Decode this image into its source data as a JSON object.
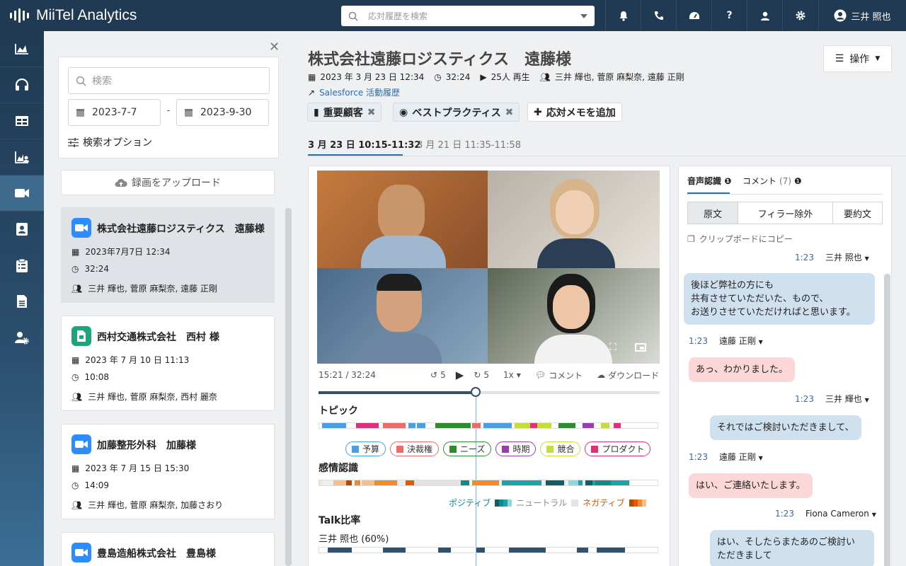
{
  "app": {
    "title": "MiiTel Analytics"
  },
  "search": {
    "placeholder": "応対履歴を検索"
  },
  "user": {
    "name": "三井 照也"
  },
  "left": {
    "search_placeholder": "検索",
    "date_from": "2023-7-7",
    "date_sep": "-",
    "date_to": "2023-9-30",
    "search_options": "検索オプション",
    "upload": "録画をアップロード",
    "items": [
      {
        "title": "株式会社遠藤ロジスティクス　遠藤様",
        "date": "2023年7月7日 12:34",
        "duration": "32:24",
        "people": "三井 輝也, 菅原 麻梨奈, 遠藤 正剛",
        "icon": "video-icon",
        "color": "#2d8cff"
      },
      {
        "title": "西村交通株式会社　西村 様",
        "date": "2023 年 7 月 10 日 11:13",
        "duration": "10:08",
        "people": "三井 輝也, 菅原 麻梨奈, 西村 麗奈",
        "icon": "meet-icon",
        "color": "#1aa67a"
      },
      {
        "title": "加藤整形外科　加藤様",
        "date": "2023 年 7 月 15 日 15:30",
        "duration": "14:09",
        "people": "三井 輝也, 菅原 麻梨奈, 加藤さおり",
        "icon": "video-icon",
        "color": "#2d8cff"
      },
      {
        "title": "豊島造船株式会社　豊島様",
        "icon": "video-icon",
        "color": "#2d8cff"
      }
    ]
  },
  "main": {
    "title": "株式会社遠藤ロジスティクス　遠藤様",
    "date": "2023 年 3 月 23 日 12:34",
    "duration": "32:24",
    "plays": "25人 再生",
    "participants": "三井 輝也, 菅原 麻梨奈, 遠藤 正剛",
    "salesforce": "Salesforce 活動履歴",
    "action": "操作",
    "tags": [
      "重要顧客",
      "ベストプラクティス"
    ],
    "add_memo": "応対メモを追加",
    "tabs": [
      "3 月 23 日 10:15-11:32",
      "3 月 21 日 11:35-11:58"
    ]
  },
  "player": {
    "time": "15:21 / 32:24",
    "back": "5",
    "fwd": "5",
    "speed": "1x",
    "comment": "コメント",
    "download": "ダウンロード",
    "progress": 0.46
  },
  "topic": {
    "title": "トピック",
    "legend": [
      {
        "label": "予算",
        "color": "#4a9ee6"
      },
      {
        "label": "決裁権",
        "color": "#f06a6a"
      },
      {
        "label": "ニーズ",
        "color": "#2e8b2e"
      },
      {
        "label": "時期",
        "color": "#9c3bb0"
      },
      {
        "label": "競合",
        "color": "#c5dd3a"
      },
      {
        "label": "プロダクト",
        "color": "#e0307a"
      }
    ]
  },
  "emotion": {
    "title": "感情認識",
    "positive": "ポジティブ",
    "neutral": "ニュートラル",
    "negative": "ネガティブ"
  },
  "talk": {
    "title": "Talk比率",
    "speaker": "三井 照也 (60%)"
  },
  "transcript": {
    "tabs": [
      "音声認識",
      "コメント"
    ],
    "comment_count": "7",
    "modes": [
      "原文",
      "フィラー除外",
      "要約文"
    ],
    "copy": "クリップボードにコピー",
    "messages": [
      {
        "time": "1:23",
        "speaker": "三井 照也",
        "side": "right",
        "text": "後ほど弊社の方にも\n共有させていただいた、もので、\nお送りさせていただければと思います。",
        "color": "blue"
      },
      {
        "time": "1:23",
        "speaker": "遠藤 正剛",
        "side": "left",
        "text": "あっ、わかりました。",
        "color": "pink"
      },
      {
        "time": "1:23",
        "speaker": "三井 輝也",
        "side": "right",
        "text": "それではご検討いただきまして、",
        "color": "blue"
      },
      {
        "time": "1:23",
        "speaker": "遠藤 正剛",
        "side": "left",
        "text": "はい、ご連絡いたします。",
        "color": "pink"
      },
      {
        "time": "1:23",
        "speaker": "Fiona Cameron",
        "side": "right",
        "text": "はい、そしたらまたあのご検討い\nただきまして",
        "color": "blue"
      }
    ]
  }
}
